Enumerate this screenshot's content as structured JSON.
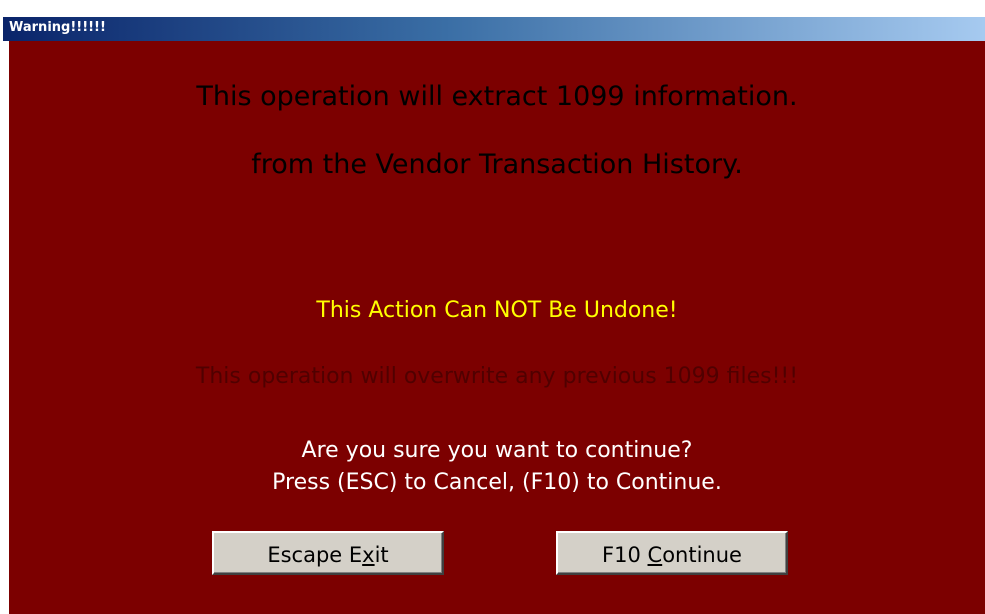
{
  "window": {
    "title": "Warning!!!!!!"
  },
  "message": {
    "heading_line1": "This operation will extract 1099 information.",
    "heading_line2": "from the Vendor Transaction History.",
    "warning": "This Action Can NOT Be Undone!",
    "overwrite_notice": "This operation will overwrite any previous 1099 files!!!",
    "confirm_question": "Are you sure you want to continue?",
    "key_instructions": "Press (ESC) to Cancel, (F10) to Continue."
  },
  "buttons": {
    "escape": {
      "before": "Escape E",
      "accel": "x",
      "after": "it"
    },
    "continue": {
      "before": "F10 ",
      "accel": "C",
      "after": "ontinue"
    }
  },
  "colors": {
    "dialog_background": "#7c0000",
    "warning_text": "#ffff00",
    "overwrite_text": "#500000",
    "prompt_text": "#ffffff",
    "button_face": "#d4d0c8",
    "titlebar_start": "#0a246a",
    "titlebar_end": "#a6caf0"
  }
}
